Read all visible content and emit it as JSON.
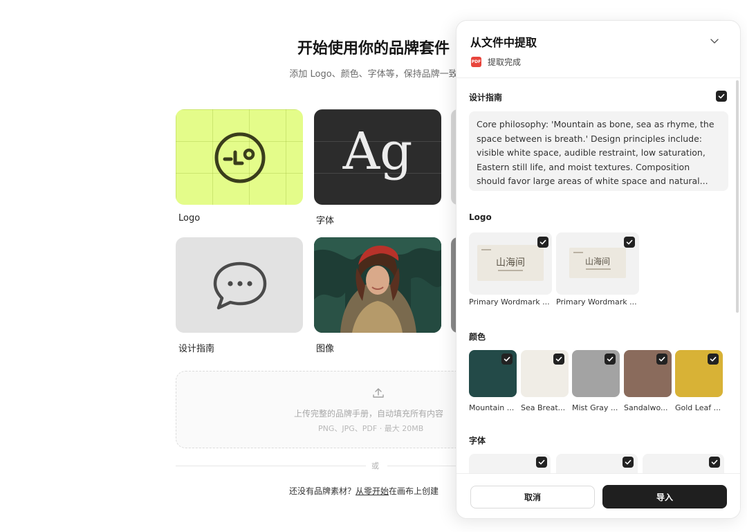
{
  "page": {
    "title": "开始使用你的品牌套件",
    "subtitle": "添加 Logo、颜色、字体等，保持品牌一致"
  },
  "cards": {
    "logo_label": "Logo",
    "font_label": "字体",
    "font_sample": "Ag",
    "guide_label": "设计指南",
    "image_label": "图像"
  },
  "upload": {
    "line1": "上传完整的品牌手册，自动填充所有内容",
    "line2": "PNG、JPG、PDF · 最大 20MB"
  },
  "divider": {
    "or": "或"
  },
  "bottom": {
    "prefix": "还没有品牌素材？",
    "link": "从零开始",
    "suffix": "在画布上创建"
  },
  "panel": {
    "title": "从文件中提取",
    "file_badge": "PDF",
    "status": "提取完成",
    "design_guide": {
      "title": "设计指南",
      "checked": true,
      "text": "Core philosophy: 'Mountain as bone, sea as rhyme, the space between is breath.' Design principles include: visible white space, audible restraint, low saturation, Eastern still life, and moist textures. Composition should favor large areas of white space and natural..."
    },
    "logo": {
      "title": "Logo",
      "items": [
        {
          "label": "Primary Wordmark ...",
          "mark": "山海间",
          "checked": true
        },
        {
          "label": "Primary Wordmark ...",
          "mark": "山海间",
          "checked": true
        }
      ]
    },
    "colors": {
      "title": "颜色",
      "items": [
        {
          "label": "Mountain ...",
          "color": "#234a48",
          "checked": true
        },
        {
          "label": "Sea Breat...",
          "color": "#f0ede6",
          "checked": true
        },
        {
          "label": "Mist Gray ...",
          "color": "#a3a3a3",
          "checked": true
        },
        {
          "label": "Sandalwo...",
          "color": "#8a6b5c",
          "checked": true
        },
        {
          "label": "Gold Leaf ...",
          "color": "#d8b236",
          "checked": true
        }
      ]
    },
    "fonts": {
      "title": "字体",
      "checked_count": 3
    },
    "footer": {
      "cancel": "取消",
      "import": "导入"
    }
  }
}
